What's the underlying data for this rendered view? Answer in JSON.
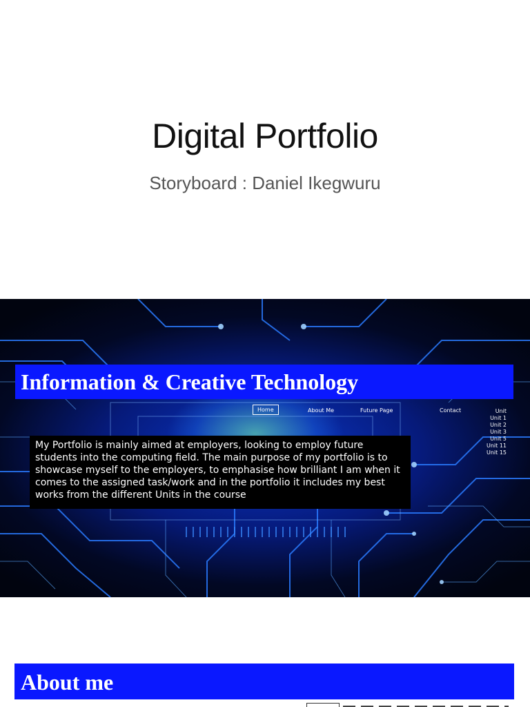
{
  "slide": {
    "title": "Digital Portfolio",
    "subtitle": "Storyboard : Daniel Ikegwuru"
  },
  "mockup": {
    "header_title": "Information & Creative Technology",
    "header_color": "#0a18ff",
    "nav": {
      "home": "Home",
      "about": "About Me",
      "future": "Future Page",
      "contact": "Contact",
      "unit": "Unit"
    },
    "units": [
      "Unit 1",
      "Unit 2",
      "Unit 3",
      "Unit 5",
      "Unit 11",
      "Unit 15"
    ],
    "intro_text": "My Portfolio is mainly aimed at employers, looking to employ future students into the computing field. The main purpose of my portfolio is to showcase myself to the employers, to emphasise how brilliant I am when it comes to the assigned task/work and in the portfolio it includes my best works from the different Units in the course"
  },
  "next_section": {
    "title": "About me"
  }
}
